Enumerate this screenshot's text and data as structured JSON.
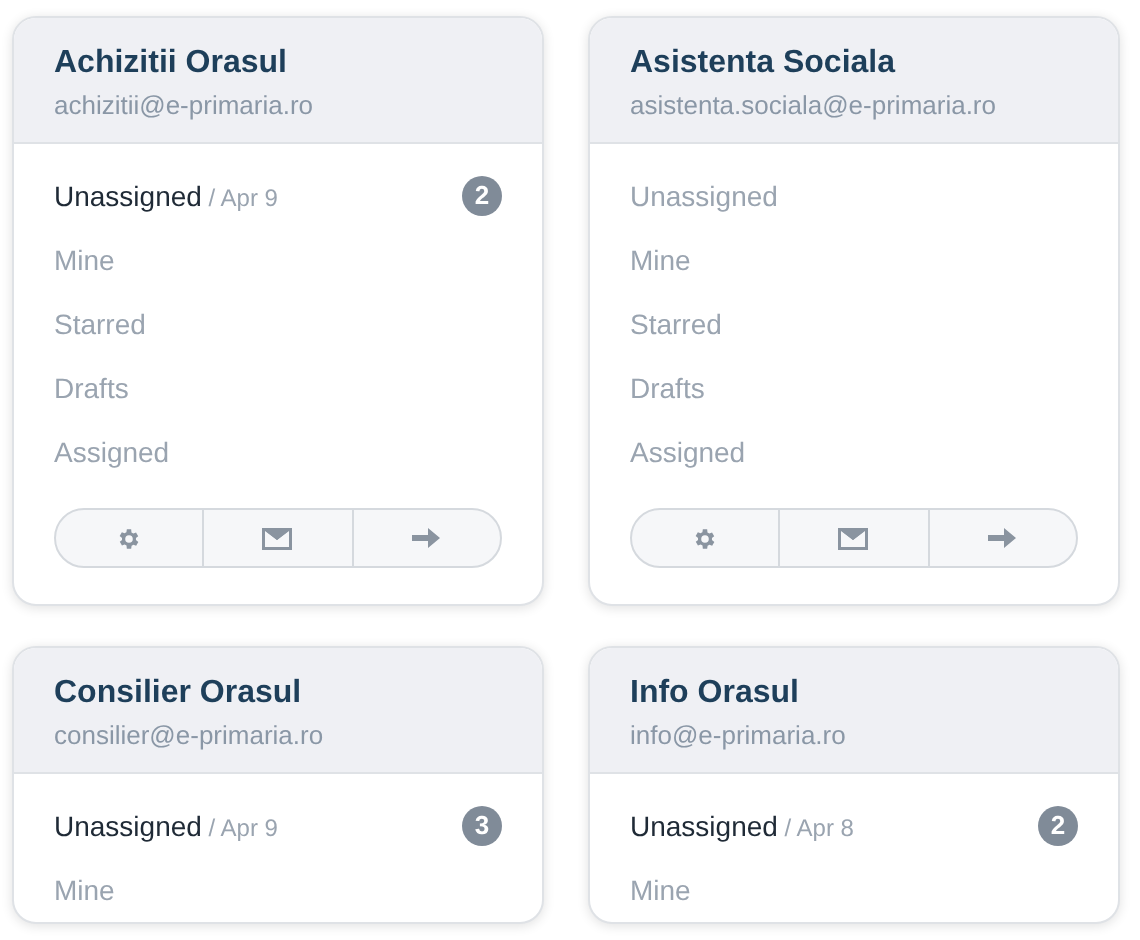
{
  "inboxes": [
    {
      "name": "Achizitii Orasul",
      "email": "achizitii@e-primaria.ro",
      "folders": [
        {
          "label": "Unassigned",
          "active": true,
          "date": "/ Apr 9",
          "count": "2"
        },
        {
          "label": "Mine",
          "active": false
        },
        {
          "label": "Starred",
          "active": false
        },
        {
          "label": "Drafts",
          "active": false
        },
        {
          "label": "Assigned",
          "active": false
        }
      ],
      "actions": true
    },
    {
      "name": "Asistenta Sociala",
      "email": "asistenta.sociala@e-primaria.ro",
      "folders": [
        {
          "label": "Unassigned",
          "active": false
        },
        {
          "label": "Mine",
          "active": false
        },
        {
          "label": "Starred",
          "active": false
        },
        {
          "label": "Drafts",
          "active": false
        },
        {
          "label": "Assigned",
          "active": false
        }
      ],
      "actions": true
    },
    {
      "name": "Consilier Orasul",
      "email": "consilier@e-primaria.ro",
      "folders": [
        {
          "label": "Unassigned",
          "active": true,
          "date": "/ Apr 9",
          "count": "3"
        },
        {
          "label": "Mine",
          "active": false
        }
      ],
      "actions": false
    },
    {
      "name": "Info Orasul",
      "email": "info@e-primaria.ro",
      "folders": [
        {
          "label": "Unassigned",
          "active": true,
          "date": "/ Apr 8",
          "count": "2"
        },
        {
          "label": "Mine",
          "active": false
        }
      ],
      "actions": false
    }
  ]
}
